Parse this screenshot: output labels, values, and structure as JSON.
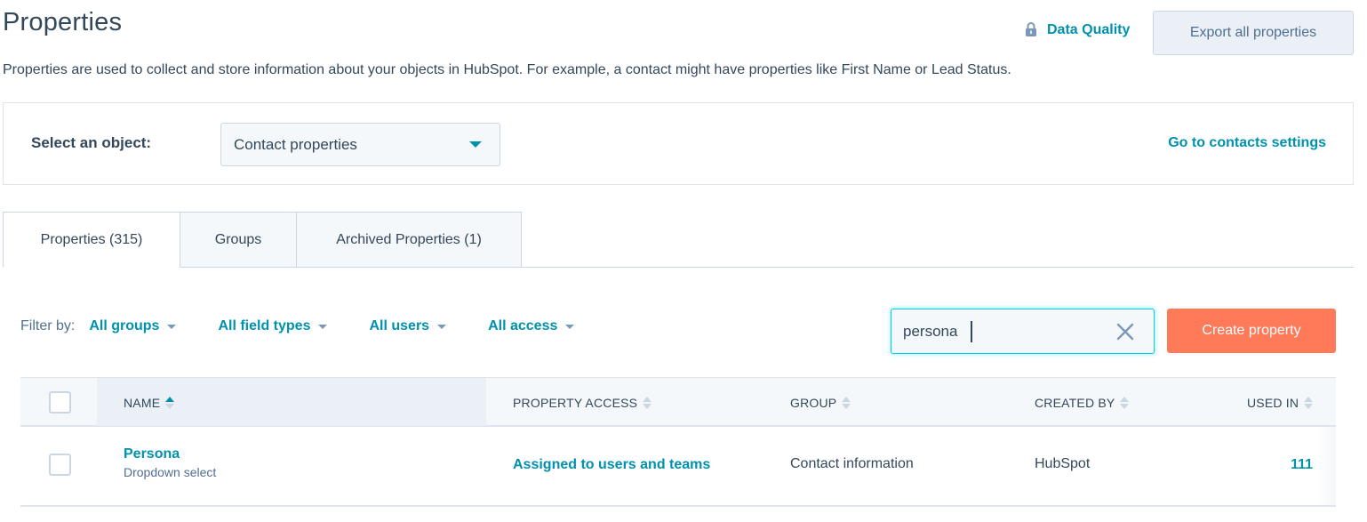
{
  "header": {
    "title": "Properties",
    "description": "Properties are used to collect and store information about your objects in HubSpot. For example, a contact might have properties like First Name or Lead Status.",
    "data_quality_label": "Data Quality",
    "data_quality_icon": "lock-icon",
    "export_label": "Export all properties"
  },
  "object_selector": {
    "label": "Select an object:",
    "selected": "Contact properties",
    "settings_link": "Go to contacts settings"
  },
  "tabs": [
    {
      "label": "Properties (315)",
      "active": true
    },
    {
      "label": "Groups",
      "active": false
    },
    {
      "label": "Archived Properties (1)",
      "active": false
    }
  ],
  "filters": {
    "label": "Filter by:",
    "items": [
      "All groups",
      "All field types",
      "All users",
      "All access"
    ]
  },
  "search": {
    "value": "persona",
    "clear_icon": "close-icon"
  },
  "create_label": "Create property",
  "table": {
    "columns": [
      "NAME",
      "PROPERTY ACCESS",
      "GROUP",
      "CREATED BY",
      "USED IN"
    ],
    "sorted_column": "NAME",
    "sort_direction": "ascending",
    "rows": [
      {
        "name": "Persona",
        "type": "Dropdown select",
        "access": "Assigned to users and teams",
        "group": "Contact information",
        "created_by": "HubSpot",
        "used_in": "111"
      }
    ]
  },
  "colors": {
    "accent": "#0091ae",
    "primary_button": "#ff7a59",
    "text": "#33475b",
    "border": "#cbd6e2",
    "header_bg": "#f5f8fa"
  }
}
